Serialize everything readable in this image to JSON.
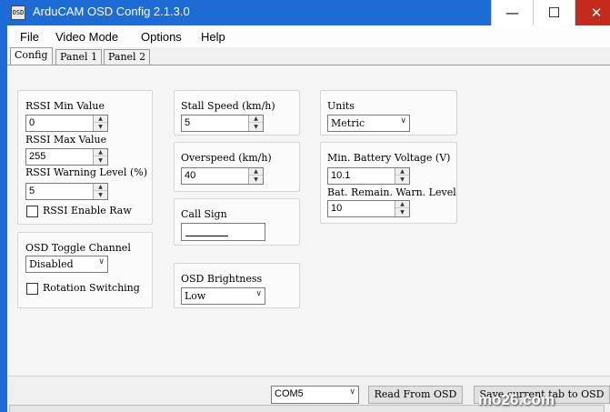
{
  "window": {
    "title": "ArduCAM OSD Config 2.1.3.0",
    "icon_text": "OSD",
    "minimize": "—",
    "maximize": "☐",
    "close": "✕"
  },
  "menu": [
    "File",
    "Video Mode",
    "Options",
    "Help"
  ],
  "tabs": [
    "Config",
    "Panel 1",
    "Panel 2"
  ],
  "rssi": {
    "min_label": "RSSI Min Value",
    "min_value": "0",
    "max_label": "RSSI Max Value",
    "max_value": "255",
    "warn_label": "RSSI Warning Level (%)",
    "warn_value": "5",
    "raw_label": "RSSI Enable Raw"
  },
  "osd_toggle": {
    "label": "OSD Toggle Channel",
    "value": "Disabled",
    "rotation_label": "Rotation Switching"
  },
  "stall": {
    "label": "Stall Speed (km/h)",
    "value": "5"
  },
  "overspeed": {
    "label": "Overspeed (km/h)",
    "value": "40"
  },
  "callsign": {
    "label": "Call Sign",
    "value": ""
  },
  "brightness": {
    "label": "OSD Brightness",
    "value": "Low"
  },
  "units": {
    "label": "Units",
    "value": "Metric"
  },
  "battery": {
    "voltage_label": "Min. Battery Voltage (V)",
    "voltage_value": "10.1",
    "remain_label": "Bat. Remain. Warn. Level",
    "remain_value": "10"
  },
  "footer": {
    "port": "COM5",
    "read_button": "Read From OSD",
    "save_button": "Save current tab to OSD"
  },
  "watermark": "mo26.com"
}
